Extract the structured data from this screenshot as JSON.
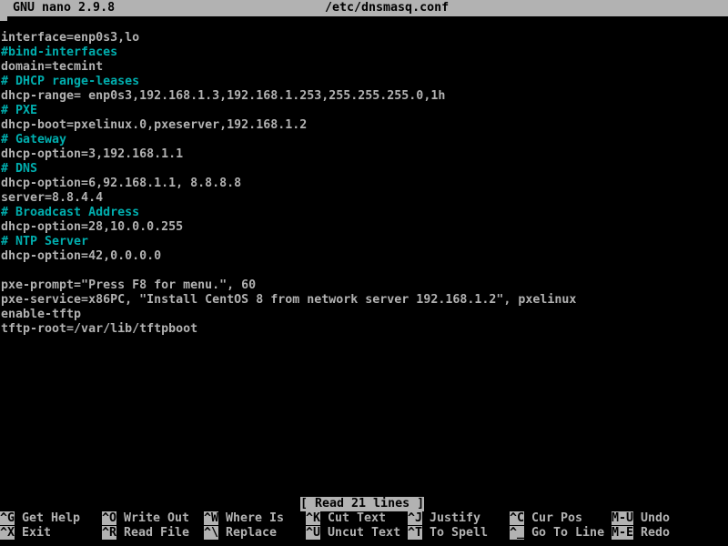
{
  "titlebar": {
    "app_version": "GNU nano 2.9.8",
    "file_path": "/etc/dnsmasq.conf"
  },
  "editor": {
    "lines": [
      {
        "text": "interface=enp0s3,lo",
        "type": "config"
      },
      {
        "text": "#bind-interfaces",
        "type": "comment"
      },
      {
        "text": "domain=tecmint",
        "type": "config"
      },
      {
        "text": "# DHCP range-leases",
        "type": "comment"
      },
      {
        "text": "dhcp-range= enp0s3,192.168.1.3,192.168.1.253,255.255.255.0,1h",
        "type": "config"
      },
      {
        "text": "# PXE",
        "type": "comment"
      },
      {
        "text": "dhcp-boot=pxelinux.0,pxeserver,192.168.1.2",
        "type": "config"
      },
      {
        "text": "# Gateway",
        "type": "comment"
      },
      {
        "text": "dhcp-option=3,192.168.1.1",
        "type": "config"
      },
      {
        "text": "# DNS",
        "type": "comment"
      },
      {
        "text": "dhcp-option=6,92.168.1.1, 8.8.8.8",
        "type": "config"
      },
      {
        "text": "server=8.8.4.4",
        "type": "config"
      },
      {
        "text": "# Broadcast Address",
        "type": "comment"
      },
      {
        "text": "dhcp-option=28,10.0.0.255",
        "type": "config"
      },
      {
        "text": "# NTP Server",
        "type": "comment"
      },
      {
        "text": "dhcp-option=42,0.0.0.0",
        "type": "config"
      },
      {
        "text": "",
        "type": "blank"
      },
      {
        "text": "pxe-prompt=\"Press F8 for menu.\", 60",
        "type": "config"
      },
      {
        "text": "pxe-service=x86PC, \"Install CentOS 8 from network server 192.168.1.2\", pxelinux",
        "type": "config"
      },
      {
        "text": "enable-tftp",
        "type": "config"
      },
      {
        "text": "tftp-root=/var/lib/tftpboot",
        "type": "config"
      }
    ]
  },
  "statusbar": {
    "message": "[ Read 21 lines ]"
  },
  "shortcuts": [
    [
      {
        "key": "^G",
        "label": "Get Help"
      },
      {
        "key": "^O",
        "label": "Write Out"
      },
      {
        "key": "^W",
        "label": "Where Is"
      },
      {
        "key": "^K",
        "label": "Cut Text"
      },
      {
        "key": "^J",
        "label": "Justify"
      },
      {
        "key": "^C",
        "label": "Cur Pos"
      },
      {
        "key": "M-U",
        "label": "Undo"
      }
    ],
    [
      {
        "key": "^X",
        "label": "Exit"
      },
      {
        "key": "^R",
        "label": "Read File"
      },
      {
        "key": "^\\",
        "label": "Replace"
      },
      {
        "key": "^U",
        "label": "Uncut Text"
      },
      {
        "key": "^T",
        "label": "To Spell"
      },
      {
        "key": "^_",
        "label": "Go To Line"
      },
      {
        "key": "M-E",
        "label": "Redo"
      }
    ]
  ],
  "colors": {
    "background": "#000000",
    "foreground": "#b2b2b2",
    "comment": "#00aeae",
    "bar_background": "#b2b2b2",
    "bar_foreground": "#000000"
  }
}
